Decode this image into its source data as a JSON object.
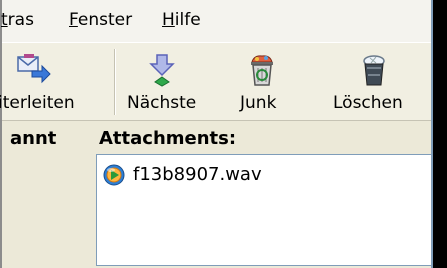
{
  "menu": {
    "items": [
      {
        "pre": "",
        "accel": "t",
        "post": "ras"
      },
      {
        "pre": "",
        "accel": "F",
        "post": "enster"
      },
      {
        "pre": "",
        "accel": "H",
        "post": "ilfe"
      }
    ]
  },
  "toolbar": {
    "forward_label": "iterleiten",
    "next_label": "Nächste",
    "junk_label": "Junk",
    "delete_label": "Löschen"
  },
  "message": {
    "left_label": "annt",
    "attachments_label": "Attachments:",
    "attachments": [
      {
        "name": "f13b8907.wav",
        "icon": "media-file-icon"
      }
    ]
  },
  "colors": {
    "window_bg": "#ece9d8",
    "box_border": "#7f9db9"
  }
}
